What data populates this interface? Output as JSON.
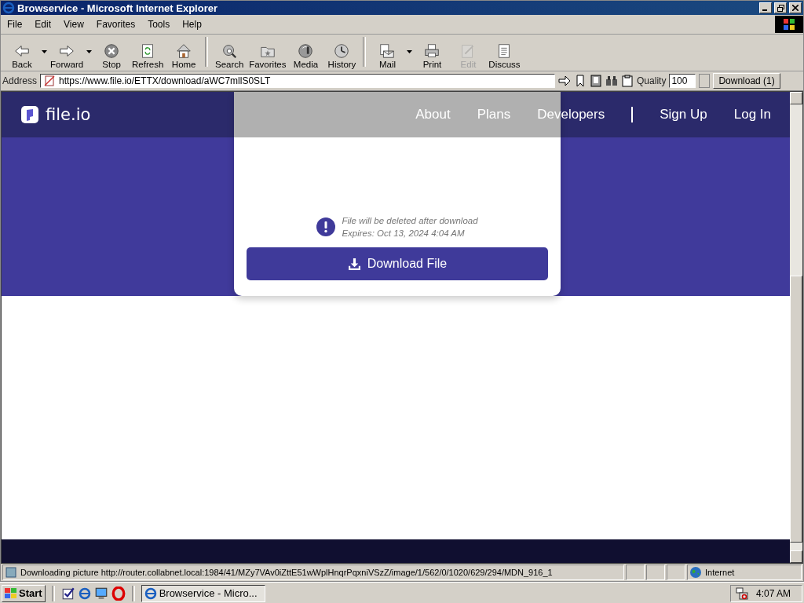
{
  "window": {
    "title": "Browservice - Microsoft Internet Explorer"
  },
  "menu": [
    {
      "label": "File"
    },
    {
      "label": "Edit"
    },
    {
      "label": "View"
    },
    {
      "label": "Favorites"
    },
    {
      "label": "Tools"
    },
    {
      "label": "Help"
    }
  ],
  "toolbar": [
    {
      "label": "Back",
      "kind": "back",
      "dropdown": true,
      "disabled": false
    },
    {
      "label": "Forward",
      "kind": "forward",
      "dropdown": true,
      "disabled": false
    },
    {
      "label": "Stop",
      "kind": "stop",
      "dropdown": false,
      "disabled": false
    },
    {
      "label": "Refresh",
      "kind": "refresh",
      "dropdown": false,
      "disabled": false
    },
    {
      "label": "Home",
      "kind": "home",
      "dropdown": false,
      "disabled": false
    },
    {
      "label": "Search",
      "kind": "search",
      "dropdown": false,
      "disabled": false,
      "separator_before": true
    },
    {
      "label": "Favorites",
      "kind": "favorites",
      "dropdown": false,
      "disabled": false
    },
    {
      "label": "Media",
      "kind": "media",
      "dropdown": false,
      "disabled": false
    },
    {
      "label": "History",
      "kind": "history",
      "dropdown": false,
      "disabled": false
    },
    {
      "label": "Mail",
      "kind": "mail",
      "dropdown": true,
      "disabled": false,
      "separator_before": true
    },
    {
      "label": "Print",
      "kind": "print",
      "dropdown": false,
      "disabled": false
    },
    {
      "label": "Edit",
      "kind": "edit",
      "dropdown": false,
      "disabled": true
    },
    {
      "label": "Discuss",
      "kind": "discuss",
      "dropdown": false,
      "disabled": false
    }
  ],
  "address_bar": {
    "label": "Address",
    "value": "https://www.file.io/ETTX/download/aWC7mllS0SLT"
  },
  "quality": {
    "label": "Quality",
    "value": "100"
  },
  "download_button": {
    "label": "Download (1)"
  },
  "page": {
    "logo": "file.io",
    "nav_left": [
      "About",
      "Plans",
      "Developers"
    ],
    "nav_right": [
      "Sign Up",
      "Log In"
    ],
    "notice": [
      "File will be deleted after download",
      "Expires: Oct 13, 2024 4:04 AM"
    ],
    "button": "Download File"
  },
  "status_bar": {
    "text": "Downloading picture http://router.collabnet.local:1984/41/MZy7VAv0iZttE51wWplHnqrPqxniVSzZ/image/1/562/0/1020/629/294/MDN_916_1",
    "zone": "Internet"
  },
  "taskbar": {
    "start": "Start",
    "tasks": [
      {
        "label": "Browservice - Micro...",
        "selected": true
      }
    ],
    "clock": "4:07 AM"
  }
}
